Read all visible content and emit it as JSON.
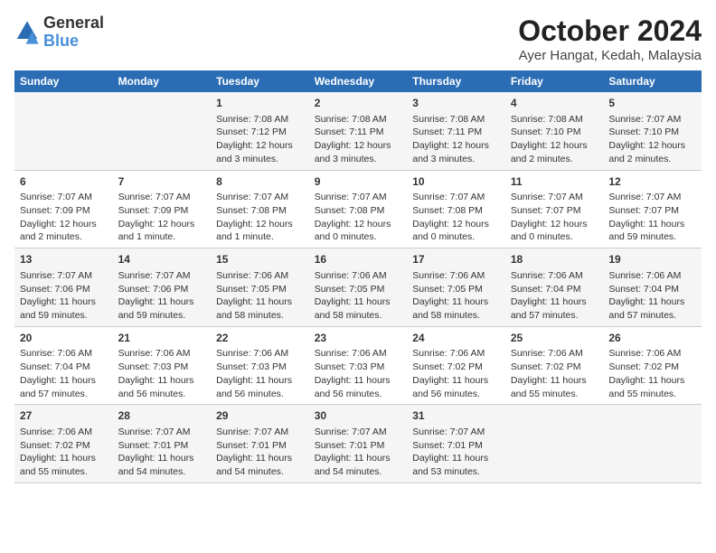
{
  "header": {
    "logo_line1": "General",
    "logo_line2": "Blue",
    "title": "October 2024",
    "subtitle": "Ayer Hangat, Kedah, Malaysia"
  },
  "columns": [
    "Sunday",
    "Monday",
    "Tuesday",
    "Wednesday",
    "Thursday",
    "Friday",
    "Saturday"
  ],
  "weeks": [
    {
      "days": [
        {
          "num": "",
          "info": ""
        },
        {
          "num": "",
          "info": ""
        },
        {
          "num": "1",
          "info": "Sunrise: 7:08 AM\nSunset: 7:12 PM\nDaylight: 12 hours and 3 minutes."
        },
        {
          "num": "2",
          "info": "Sunrise: 7:08 AM\nSunset: 7:11 PM\nDaylight: 12 hours and 3 minutes."
        },
        {
          "num": "3",
          "info": "Sunrise: 7:08 AM\nSunset: 7:11 PM\nDaylight: 12 hours and 3 minutes."
        },
        {
          "num": "4",
          "info": "Sunrise: 7:08 AM\nSunset: 7:10 PM\nDaylight: 12 hours and 2 minutes."
        },
        {
          "num": "5",
          "info": "Sunrise: 7:07 AM\nSunset: 7:10 PM\nDaylight: 12 hours and 2 minutes."
        }
      ]
    },
    {
      "days": [
        {
          "num": "6",
          "info": "Sunrise: 7:07 AM\nSunset: 7:09 PM\nDaylight: 12 hours and 2 minutes."
        },
        {
          "num": "7",
          "info": "Sunrise: 7:07 AM\nSunset: 7:09 PM\nDaylight: 12 hours and 1 minute."
        },
        {
          "num": "8",
          "info": "Sunrise: 7:07 AM\nSunset: 7:08 PM\nDaylight: 12 hours and 1 minute."
        },
        {
          "num": "9",
          "info": "Sunrise: 7:07 AM\nSunset: 7:08 PM\nDaylight: 12 hours and 0 minutes."
        },
        {
          "num": "10",
          "info": "Sunrise: 7:07 AM\nSunset: 7:08 PM\nDaylight: 12 hours and 0 minutes."
        },
        {
          "num": "11",
          "info": "Sunrise: 7:07 AM\nSunset: 7:07 PM\nDaylight: 12 hours and 0 minutes."
        },
        {
          "num": "12",
          "info": "Sunrise: 7:07 AM\nSunset: 7:07 PM\nDaylight: 11 hours and 59 minutes."
        }
      ]
    },
    {
      "days": [
        {
          "num": "13",
          "info": "Sunrise: 7:07 AM\nSunset: 7:06 PM\nDaylight: 11 hours and 59 minutes."
        },
        {
          "num": "14",
          "info": "Sunrise: 7:07 AM\nSunset: 7:06 PM\nDaylight: 11 hours and 59 minutes."
        },
        {
          "num": "15",
          "info": "Sunrise: 7:06 AM\nSunset: 7:05 PM\nDaylight: 11 hours and 58 minutes."
        },
        {
          "num": "16",
          "info": "Sunrise: 7:06 AM\nSunset: 7:05 PM\nDaylight: 11 hours and 58 minutes."
        },
        {
          "num": "17",
          "info": "Sunrise: 7:06 AM\nSunset: 7:05 PM\nDaylight: 11 hours and 58 minutes."
        },
        {
          "num": "18",
          "info": "Sunrise: 7:06 AM\nSunset: 7:04 PM\nDaylight: 11 hours and 57 minutes."
        },
        {
          "num": "19",
          "info": "Sunrise: 7:06 AM\nSunset: 7:04 PM\nDaylight: 11 hours and 57 minutes."
        }
      ]
    },
    {
      "days": [
        {
          "num": "20",
          "info": "Sunrise: 7:06 AM\nSunset: 7:04 PM\nDaylight: 11 hours and 57 minutes."
        },
        {
          "num": "21",
          "info": "Sunrise: 7:06 AM\nSunset: 7:03 PM\nDaylight: 11 hours and 56 minutes."
        },
        {
          "num": "22",
          "info": "Sunrise: 7:06 AM\nSunset: 7:03 PM\nDaylight: 11 hours and 56 minutes."
        },
        {
          "num": "23",
          "info": "Sunrise: 7:06 AM\nSunset: 7:03 PM\nDaylight: 11 hours and 56 minutes."
        },
        {
          "num": "24",
          "info": "Sunrise: 7:06 AM\nSunset: 7:02 PM\nDaylight: 11 hours and 56 minutes."
        },
        {
          "num": "25",
          "info": "Sunrise: 7:06 AM\nSunset: 7:02 PM\nDaylight: 11 hours and 55 minutes."
        },
        {
          "num": "26",
          "info": "Sunrise: 7:06 AM\nSunset: 7:02 PM\nDaylight: 11 hours and 55 minutes."
        }
      ]
    },
    {
      "days": [
        {
          "num": "27",
          "info": "Sunrise: 7:06 AM\nSunset: 7:02 PM\nDaylight: 11 hours and 55 minutes."
        },
        {
          "num": "28",
          "info": "Sunrise: 7:07 AM\nSunset: 7:01 PM\nDaylight: 11 hours and 54 minutes."
        },
        {
          "num": "29",
          "info": "Sunrise: 7:07 AM\nSunset: 7:01 PM\nDaylight: 11 hours and 54 minutes."
        },
        {
          "num": "30",
          "info": "Sunrise: 7:07 AM\nSunset: 7:01 PM\nDaylight: 11 hours and 54 minutes."
        },
        {
          "num": "31",
          "info": "Sunrise: 7:07 AM\nSunset: 7:01 PM\nDaylight: 11 hours and 53 minutes."
        },
        {
          "num": "",
          "info": ""
        },
        {
          "num": "",
          "info": ""
        }
      ]
    }
  ]
}
